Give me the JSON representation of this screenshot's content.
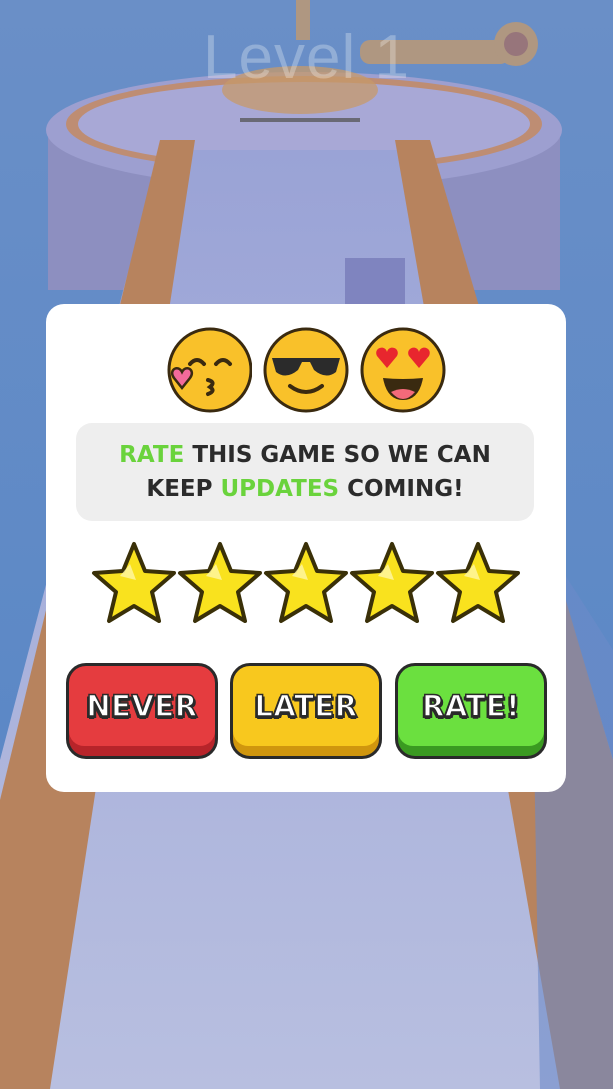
{
  "level": {
    "title": "Level 1"
  },
  "rating_dialog": {
    "emojis": [
      "kissing-face-icon",
      "sunglasses-face-icon",
      "heart-eyes-face-icon"
    ],
    "message": {
      "line1": {
        "highlight": "RATE",
        "rest": " THIS GAME SO WE CAN"
      },
      "line2": {
        "pre": "KEEP ",
        "highlight": "UPDATES",
        "post": " COMING!"
      }
    },
    "stars": {
      "count": 5,
      "filled": 5
    },
    "buttons": {
      "never": "NEVER",
      "later": "LATER",
      "rate": "RATE!"
    }
  },
  "colors": {
    "highlight": "#6ad33c",
    "never": "#e53c3f",
    "later": "#f8c81e",
    "rate": "#6be03f",
    "star": "#f9e21e"
  }
}
